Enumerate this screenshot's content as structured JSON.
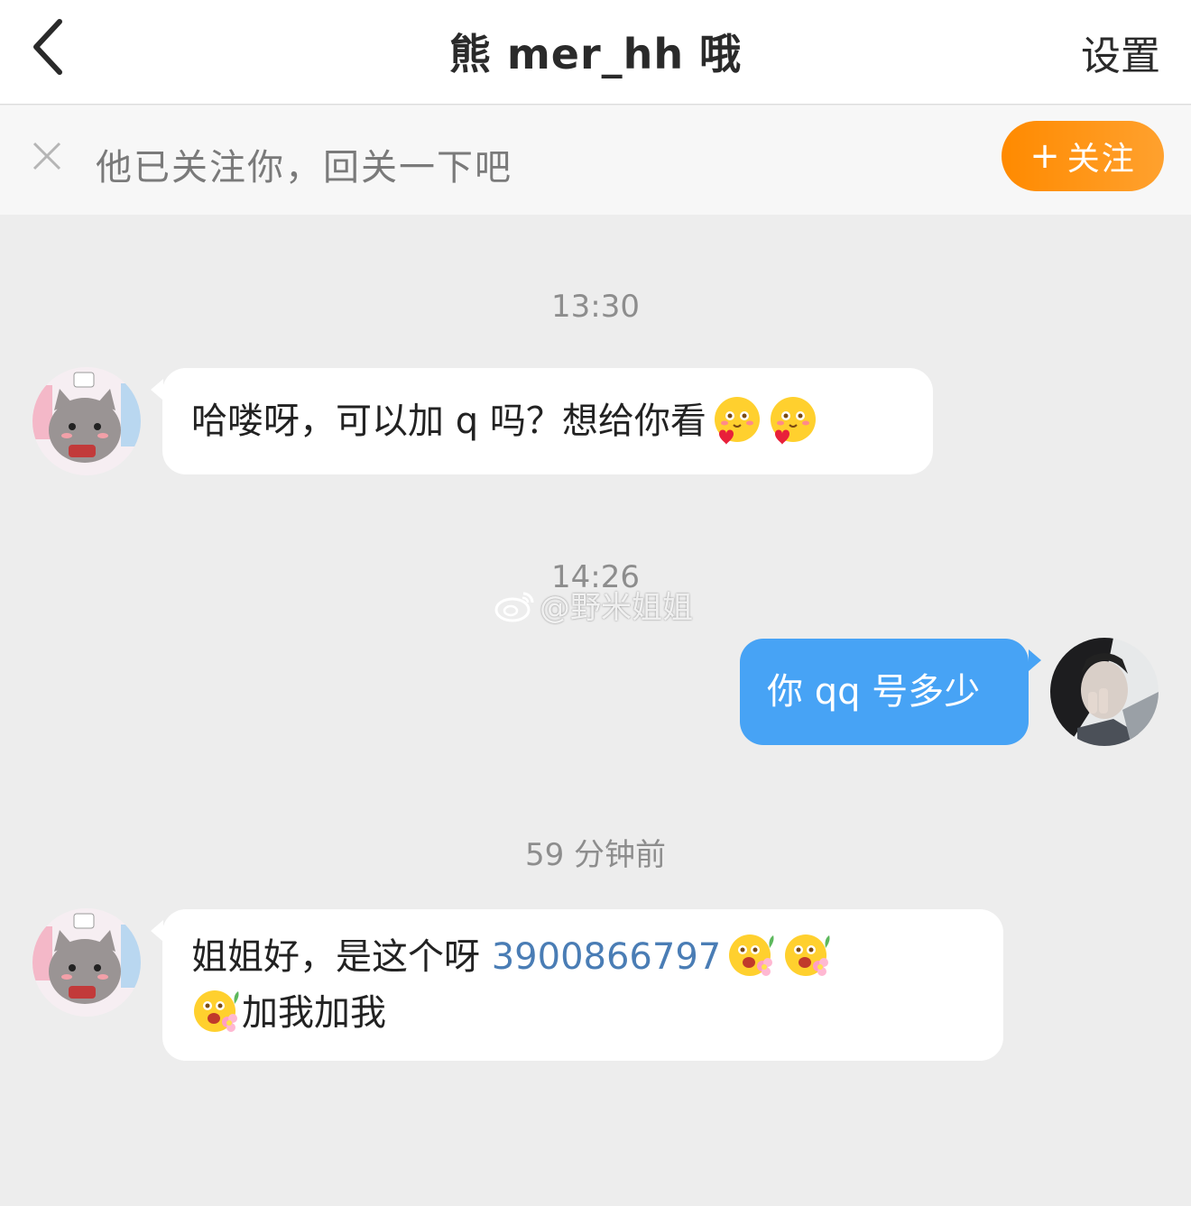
{
  "navbar": {
    "title": "熊 mer_hh 哦",
    "settings_label": "设置"
  },
  "follow_bar": {
    "text": "他已关注你，回关一下吧",
    "button_plus": "+",
    "button_label": "关注"
  },
  "messages": [
    {
      "timestamp": "13:30",
      "direction": "incoming",
      "text": "哈喽呀，可以加 q 吗？想给你看",
      "emojis": [
        "love-face-emoji",
        "love-face-emoji"
      ]
    },
    {
      "timestamp": "14:26",
      "direction": "outgoing",
      "text": "你 qq 号多少"
    },
    {
      "timestamp": "59 分钟前",
      "direction": "incoming",
      "text_before": "姐姐好，是这个呀 ",
      "qq_number": "3900866797",
      "text_after": "加我加我",
      "emojis": [
        "flower-face-emoji",
        "flower-face-emoji",
        "flower-face-emoji"
      ]
    }
  ],
  "watermark": "@野米姐姐",
  "colors": {
    "follow_button": "#ff8a00",
    "outgoing_bubble": "#47a3f5",
    "link": "#4a7db5",
    "background": "#ededed"
  }
}
